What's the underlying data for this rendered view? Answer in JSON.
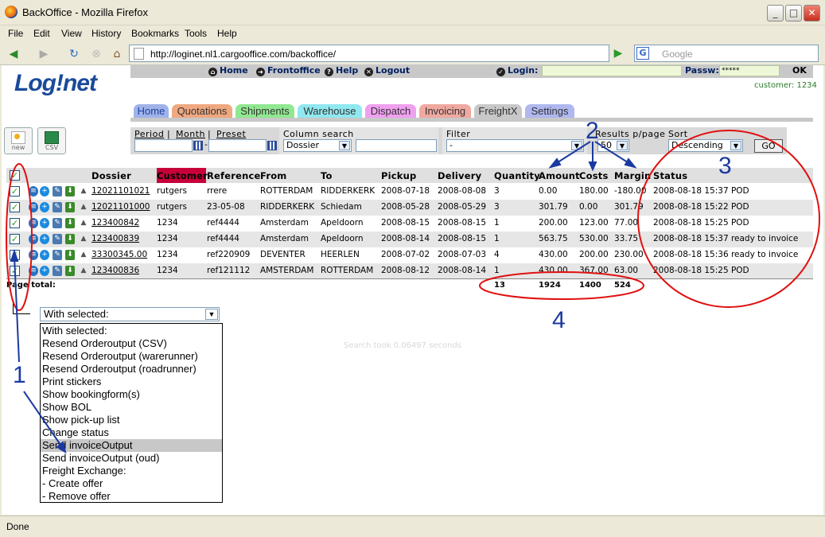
{
  "window": {
    "title": "BackOffice - Mozilla Firefox"
  },
  "menu": [
    "File",
    "Edit",
    "View",
    "History",
    "Bookmarks",
    "Tools",
    "Help"
  ],
  "nav": {
    "url": "http://loginet.nl1.cargooffice.com/backoffice/",
    "search_placeholder": "Google"
  },
  "app": {
    "logo": "Log!net",
    "toplinks": {
      "home": "Home",
      "frontoffice": "Frontoffice",
      "help": "Help",
      "logout": "Logout"
    },
    "login_label": "Login:",
    "passw_label": "Passw:",
    "passw_value": "*****",
    "ok": "OK",
    "customer": "customer: 1234"
  },
  "tabs": [
    {
      "label": "Home",
      "color": "#9fb3e8"
    },
    {
      "label": "Quotations",
      "color": "#f0a880"
    },
    {
      "label": "Shipments",
      "color": "#90e890"
    },
    {
      "label": "Warehouse",
      "color": "#90e8f0"
    },
    {
      "label": "Dispatch",
      "color": "#f0a0f0"
    },
    {
      "label": "Invoicing",
      "color": "#f0a8a0"
    },
    {
      "label": "FreightX",
      "color": "#c8c8c8"
    },
    {
      "label": "Settings",
      "color": "#b0b8f0"
    }
  ],
  "buttons": {
    "new": "new",
    "csv": "CSV"
  },
  "filters": {
    "period": "Period",
    "month": "Month",
    "preset": "Preset",
    "column_search": "Column search",
    "column_search_value": "Dossier",
    "filter": "Filter",
    "filter_value": "-",
    "results": "Results p/page",
    "results_value": "50",
    "sort": "Sort",
    "sort_value": "Descending",
    "go": "GO"
  },
  "table": {
    "headers": {
      "dossier": "Dossier",
      "customer": "Customer",
      "reference": "Reference",
      "from": "From",
      "to": "To",
      "pickup": "Pickup",
      "delivery": "Delivery",
      "quantity": "Quantity",
      "amount": "Amount",
      "costs": "Costs",
      "margin": "Margin",
      "status": "Status"
    },
    "rows": [
      {
        "dossier": "12021101021",
        "customer": "rutgers",
        "reference": "rrere",
        "from": "ROTTERDAM",
        "to": "RIDDERKERK",
        "pickup": "2008-07-18",
        "delivery": "2008-08-08",
        "quantity": "3",
        "amount": "0.00",
        "costs": "180.00",
        "margin": "-180.00",
        "status": "2008-08-18 15:37 POD"
      },
      {
        "dossier": "12021101000",
        "customer": "rutgers",
        "reference": "23-05-08",
        "from": "RIDDERKERK",
        "to": "Schiedam",
        "pickup": "2008-05-28",
        "delivery": "2008-05-29",
        "quantity": "3",
        "amount": "301.79",
        "costs": "0.00",
        "margin": "301.79",
        "status": "2008-08-18 15:22 POD"
      },
      {
        "dossier": "123400842",
        "customer": "1234",
        "reference": "ref4444",
        "from": "Amsterdam",
        "to": "Apeldoorn",
        "pickup": "2008-08-15",
        "delivery": "2008-08-15",
        "quantity": "1",
        "amount": "200.00",
        "costs": "123.00",
        "margin": "77.00",
        "status": "2008-08-18 15:25 POD"
      },
      {
        "dossier": "123400839",
        "customer": "1234",
        "reference": "ref4444",
        "from": "Amsterdam",
        "to": "Apeldoorn",
        "pickup": "2008-08-14",
        "delivery": "2008-08-15",
        "quantity": "1",
        "amount": "563.75",
        "costs": "530.00",
        "margin": "33.75",
        "status": "2008-08-18 15:37 ready to invoice"
      },
      {
        "dossier": "33300345.00",
        "customer": "1234",
        "reference": "ref220909",
        "from": "DEVENTER",
        "to": "HEERLEN",
        "pickup": "2008-07-02",
        "delivery": "2008-07-03",
        "quantity": "4",
        "amount": "430.00",
        "costs": "200.00",
        "margin": "230.00",
        "status": "2008-08-18 15:36 ready to invoice"
      },
      {
        "dossier": "123400836",
        "customer": "1234",
        "reference": "ref121112",
        "from": "AMSTERDAM",
        "to": "ROTTERDAM",
        "pickup": "2008-08-12",
        "delivery": "2008-08-14",
        "quantity": "1",
        "amount": "430.00",
        "costs": "367.00",
        "margin": "63.00",
        "status": "2008-08-18 15:25 POD"
      }
    ],
    "page_total_label": "Page total:",
    "totals": {
      "quantity": "13",
      "amount": "1924",
      "costs": "1400",
      "margin": "524"
    }
  },
  "with_selected": {
    "current": "With selected:",
    "options": [
      "With selected:",
      "Resend Orderoutput (CSV)",
      "Resend Orderoutput (warerunner)",
      "Resend Orderoutput (roadrunner)",
      "Print stickers",
      "Show bookingform(s)",
      "Show BOL",
      "Show pick-up list",
      "Change status",
      "Send invoiceOutput",
      "Send invoiceOutput (oud)",
      "Freight Exchange:",
      "- Create offer",
      "- Remove offer"
    ],
    "highlighted": "Send invoiceOutput"
  },
  "search_took": "Search took 0.06497 seconds",
  "statusbar": "Done",
  "annotations": [
    "1",
    "2",
    "3",
    "4"
  ]
}
